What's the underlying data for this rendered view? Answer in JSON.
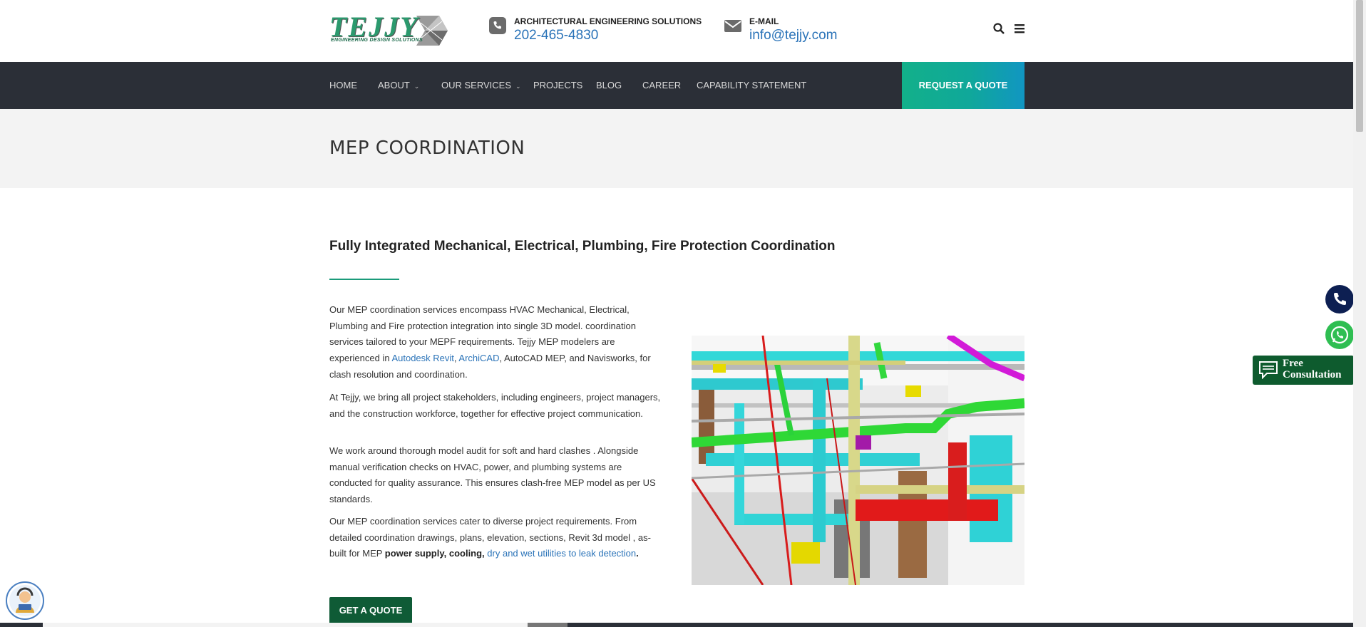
{
  "header": {
    "logo_text": "TEJJY",
    "logo_tagline": "ENGINEERING DESIGN SOLUTIONS",
    "phone_label": "ARCHITECTURAL ENGINEERING SOLUTIONS",
    "phone_number": "202-465-4830",
    "email_label": "E-MAIL",
    "email_address": "info@tejjy.com",
    "icons": [
      "phone-icon",
      "mail-icon",
      "search-icon",
      "menu-icon"
    ]
  },
  "nav": {
    "items": [
      {
        "label": "HOME"
      },
      {
        "label": "ABOUT"
      },
      {
        "label": "OUR SERVICES"
      },
      {
        "label": "PROJECTS"
      },
      {
        "label": "BLOG"
      },
      {
        "label": "CAREER"
      },
      {
        "label": "CAPABILITY STATEMENT"
      }
    ],
    "cta_label": "REQUEST A QUOTE"
  },
  "page": {
    "title": "MEP COORDINATION",
    "heading": "Fully Integrated Mechanical, Electrical, Plumbing, Fire Protection Coordination",
    "p1_a": "Our MEP coordination services encompass HVAC Mechanical, Electrical, Plumbing and Fire protection integration into single 3D model. coordination services tailored to your MEPF requirements. Tejjy MEP modelers are experienced in ",
    "p1_link1": "Autodesk Revit",
    "p1_sep": ", ",
    "p1_link2": "ArchiCAD",
    "p1_b": ", AutoCAD MEP, and Navisworks, for clash resolution and coordination.",
    "p2": "At Tejjy, we bring all project stakeholders, including engineers, project managers, and the construction workforce, together for effective project communication.",
    "p3": "We work around thorough model audit for soft and hard clashes . Alongside manual verification checks on HVAC, power, and plumbing systems are conducted for quality assurance. This ensures clash-free MEP model as per US standards.",
    "p4_a": "Our MEP coordination services cater to diverse project requirements. From detailed coordination drawings, plans, elevation, sections, Revit 3d model , as-built for MEP ",
    "p4_bold": "power supply, cooling, ",
    "p4_link": "dry and wet utilities to leak detection",
    "p4_end": ".",
    "button_label": "GET A QUOTE"
  },
  "floating": {
    "consult_line1": "Free",
    "consult_line2": "Consultation",
    "icons": [
      "phone-icon",
      "whatsapp-icon",
      "chat-icon",
      "agent-avatar-icon"
    ]
  },
  "colors": {
    "nav_bg": "#2b2f37",
    "accent_green": "#1a9b7a",
    "link_blue": "#2a73b8",
    "button_green": "#0f5b36"
  }
}
